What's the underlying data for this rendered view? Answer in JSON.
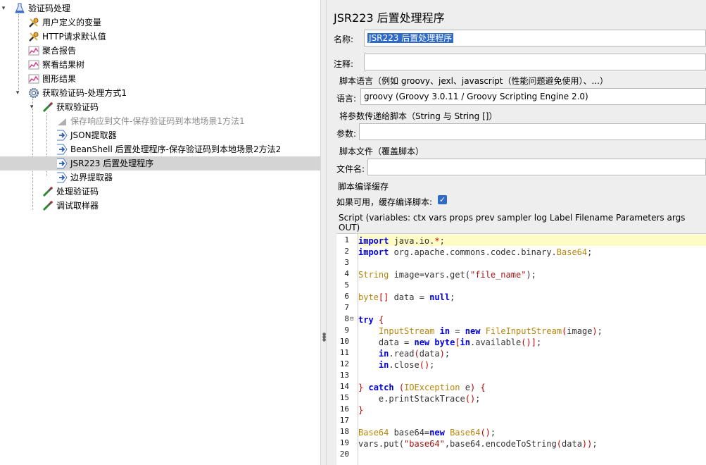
{
  "tree": {
    "nodes": [
      {
        "label": "验证码处理",
        "icon": "test-plan-flask-icon",
        "toggle": "▾",
        "disabled": false
      },
      {
        "label": "用户定义的变量",
        "icon": "wrench-config-icon",
        "toggle": "",
        "disabled": false
      },
      {
        "label": "HTTP请求默认值",
        "icon": "wrench-config-icon",
        "toggle": "",
        "disabled": false
      },
      {
        "label": "聚合报告",
        "icon": "chart-listener-icon",
        "toggle": "",
        "disabled": false
      },
      {
        "label": "察看结果树",
        "icon": "chart-listener-icon",
        "toggle": "",
        "disabled": false
      },
      {
        "label": "图形结果",
        "icon": "chart-listener-icon",
        "toggle": "",
        "disabled": false
      },
      {
        "label": "获取验证码-处理方式1",
        "icon": "gear-thread-group-icon",
        "toggle": "▾",
        "disabled": false
      },
      {
        "label": "获取验证码",
        "icon": "pipette-sampler-icon",
        "toggle": "▾",
        "disabled": false
      },
      {
        "label": "保存响应到文件-保存验证码到本地场景1方法1",
        "icon": "disabled-listener-icon",
        "toggle": "",
        "disabled": true
      },
      {
        "label": "JSON提取器",
        "icon": "post-processor-arrow-icon",
        "toggle": "",
        "disabled": false
      },
      {
        "label": "BeanShell 后置处理程序-保存验证码到本地场景2方法2",
        "icon": "post-processor-arrow-icon",
        "toggle": "",
        "disabled": false
      },
      {
        "label": "JSR223 后置处理程序",
        "icon": "post-processor-arrow-icon",
        "toggle": "",
        "disabled": false
      },
      {
        "label": "边界提取器",
        "icon": "post-processor-arrow-icon",
        "toggle": "",
        "disabled": false
      },
      {
        "label": "处理验证码",
        "icon": "pipette-sampler-icon",
        "toggle": "",
        "disabled": false
      },
      {
        "label": "调试取样器",
        "icon": "pipette-sampler-icon",
        "toggle": "",
        "disabled": false
      }
    ],
    "selected_index": 11
  },
  "panel": {
    "title": "JSR223 后置处理程序",
    "name_label": "名称:",
    "name_value": "JSR223 后置处理程序",
    "comment_label": "注释:",
    "comment_value": "",
    "lang_section": "脚本语言（例如 groovy、jexl、javascript（性能问题避免使用）、...）",
    "lang_label": "语言:",
    "lang_value": "groovy     (Groovy 3.0.11 / Groovy Scripting Engine 2.0)",
    "params_section": "将参数传递给脚本（String 与 String []）",
    "params_label": "参数:",
    "params_value": "",
    "file_section": "脚本文件（覆盖脚本）",
    "file_label": "文件名:",
    "file_value": "",
    "cache_section": "脚本编译缓存",
    "cache_label": "如果可用，缓存编译脚本:",
    "cache_checked": true,
    "script_label": "Script (variables: ctx vars props prev sampler log Label Filename Parameters args OUT)"
  },
  "editor": {
    "lines": [
      {
        "n": "1",
        "fold": ""
      },
      {
        "n": "2",
        "fold": ""
      },
      {
        "n": "3",
        "fold": ""
      },
      {
        "n": "4",
        "fold": ""
      },
      {
        "n": "5",
        "fold": ""
      },
      {
        "n": "6",
        "fold": ""
      },
      {
        "n": "7",
        "fold": ""
      },
      {
        "n": "8",
        "fold": "⊟"
      },
      {
        "n": "9",
        "fold": ""
      },
      {
        "n": "10",
        "fold": ""
      },
      {
        "n": "11",
        "fold": ""
      },
      {
        "n": "12",
        "fold": ""
      },
      {
        "n": "13",
        "fold": ""
      },
      {
        "n": "14",
        "fold": ""
      },
      {
        "n": "15",
        "fold": ""
      },
      {
        "n": "16",
        "fold": ""
      },
      {
        "n": "17",
        "fold": ""
      },
      {
        "n": "18",
        "fold": ""
      },
      {
        "n": "19",
        "fold": ""
      },
      {
        "n": "20",
        "fold": ""
      }
    ],
    "code": [
      [
        [
          "kw",
          "import"
        ],
        [
          "pk",
          " java.io."
        ],
        [
          "br",
          "*"
        ],
        [
          "pk",
          ";"
        ]
      ],
      [
        [
          "kw",
          "import"
        ],
        [
          "pk",
          " org.apache.commons.codec.binary."
        ],
        [
          "ty",
          "Base64"
        ],
        [
          "pk",
          ";"
        ]
      ],
      [],
      [
        [
          "ty",
          "String"
        ],
        [
          "pk",
          " image=vars.get("
        ],
        [
          "st",
          "\"file_name\""
        ],
        [
          "pk",
          ");"
        ]
      ],
      [],
      [
        [
          "ty",
          "byte"
        ],
        [
          "br",
          "[]"
        ],
        [
          "pk",
          " data = "
        ],
        [
          "kw",
          "null"
        ],
        [
          "pk",
          ";"
        ]
      ],
      [],
      [
        [
          "kw",
          "try"
        ],
        [
          "pk",
          " "
        ],
        [
          "br",
          "{"
        ]
      ],
      [
        [
          "pk",
          "    "
        ],
        [
          "ty",
          "InputStream"
        ],
        [
          "pk",
          " "
        ],
        [
          "kw",
          "in"
        ],
        [
          "pk",
          " = "
        ],
        [
          "kw",
          "new"
        ],
        [
          "pk",
          " "
        ],
        [
          "ty",
          "FileInputStream"
        ],
        [
          "br",
          "("
        ],
        [
          "pk",
          "image"
        ],
        [
          "br",
          ")"
        ],
        [
          "pk",
          ";"
        ]
      ],
      [
        [
          "pk",
          "    data = "
        ],
        [
          "kw",
          "new"
        ],
        [
          "pk",
          " "
        ],
        [
          "kw",
          "byte"
        ],
        [
          "br",
          "["
        ],
        [
          "kw",
          "in"
        ],
        [
          "pk",
          ".available"
        ],
        [
          "br",
          "()]"
        ],
        [
          "pk",
          ";"
        ]
      ],
      [
        [
          "pk",
          "    "
        ],
        [
          "kw",
          "in"
        ],
        [
          "pk",
          ".read"
        ],
        [
          "br",
          "("
        ],
        [
          "pk",
          "data"
        ],
        [
          "br",
          ")"
        ],
        [
          "pk",
          ";"
        ]
      ],
      [
        [
          "pk",
          "    "
        ],
        [
          "kw",
          "in"
        ],
        [
          "pk",
          ".close"
        ],
        [
          "br",
          "()"
        ],
        [
          "pk",
          ";"
        ]
      ],
      [],
      [
        [
          "br",
          "}"
        ],
        [
          "pk",
          " "
        ],
        [
          "kw",
          "catch"
        ],
        [
          "pk",
          " "
        ],
        [
          "br",
          "("
        ],
        [
          "ty",
          "IOException"
        ],
        [
          "pk",
          " e"
        ],
        [
          "br",
          ")"
        ],
        [
          "pk",
          " "
        ],
        [
          "br",
          "{"
        ]
      ],
      [
        [
          "pk",
          "    e.printStackTrace"
        ],
        [
          "br",
          "()"
        ],
        [
          "pk",
          ";"
        ]
      ],
      [
        [
          "br",
          "}"
        ]
      ],
      [],
      [
        [
          "ty",
          "Base64"
        ],
        [
          "pk",
          " base64="
        ],
        [
          "kw",
          "new"
        ],
        [
          "pk",
          " "
        ],
        [
          "ty",
          "Base64"
        ],
        [
          "br",
          "()"
        ],
        [
          "pk",
          ";"
        ]
      ],
      [
        [
          "pk",
          "vars.put("
        ],
        [
          "st",
          "\"base64\""
        ],
        [
          "pk",
          ",base64.encodeToString"
        ],
        [
          "br",
          "("
        ],
        [
          "pk",
          "data"
        ],
        [
          "br",
          "))"
        ],
        [
          "pk",
          ";"
        ]
      ],
      []
    ]
  },
  "colors": {
    "selection": "#2f6ac7",
    "line_highlight": "#fefcc4",
    "keyword": "#0000e0",
    "type": "#b8860b",
    "string": "#a31515"
  }
}
